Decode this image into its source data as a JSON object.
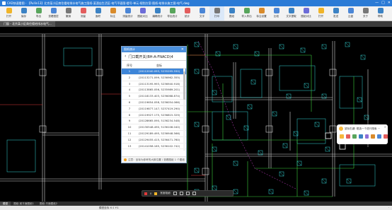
{
  "window": {
    "title": "CAD快速看图 - 【Pullin13】北京某小区商住楼给排水电气施工图纸-某酒店生活区-电气平面图-楼号-单元-规划方案-图纸-给排水施工图-电气.dwg",
    "controls": [
      "—",
      "□",
      "✕"
    ]
  },
  "toolbar": {
    "items": [
      {
        "label": "打开",
        "color": "#f0b429"
      },
      {
        "label": "保存",
        "color": "#3b82c4"
      },
      {
        "label": "导出",
        "color": "#58a55c"
      },
      {
        "label": "查看图层",
        "color": "#4b86d6"
      },
      {
        "label": "撤销",
        "color": "#777777"
      },
      {
        "label": "测量",
        "color": "#e35d5d"
      },
      {
        "label": "面积",
        "color": "#3b82c4"
      },
      {
        "label": "标注",
        "color": "#d98b2b"
      },
      {
        "label": "测量统计",
        "color": "#4b86d6"
      },
      {
        "label": "图纸对比",
        "color": "#6c6cd8"
      },
      {
        "label": "编辑统计",
        "color": "#3b82c4"
      },
      {
        "label": "导出统计",
        "color": "#58a55c"
      },
      {
        "label": "统计",
        "color": "#e35d5d"
      },
      {
        "label": "文字",
        "color": "#4b86d6"
      },
      {
        "label": "打印",
        "color": "#777777"
      },
      {
        "label": "图纸",
        "color": "#3b82c4"
      },
      {
        "label": "导入导出",
        "color": "#58a55c"
      },
      {
        "label": "标注设置",
        "color": "#d98b2b"
      },
      {
        "label": "比较",
        "color": "#4b86d6"
      },
      {
        "label": "文字提取",
        "color": "#3b82c4"
      },
      {
        "label": "图纸对比",
        "color": "#6c6cd8"
      },
      {
        "label": "打开",
        "color": "#f0b429"
      },
      {
        "label": "发送",
        "color": "#3b82c4"
      },
      {
        "label": "云盘",
        "color": "#4b86d6"
      },
      {
        "label": "关于",
        "color": "#777777"
      },
      {
        "label": "帮助",
        "color": "#3b82c4"
      }
    ]
  },
  "file_tab": "门窗 - 北京某小区商住楼给排水电气...",
  "dialog": {
    "header": "图纸统计",
    "back": "‹",
    "title": "门口截开关(BH-A-FNACD)4",
    "columns": [
      "序号",
      "坐标"
    ],
    "rows": [
      {
        "no": "1",
        "coord": "(20112040.093, 5235295.550)"
      },
      {
        "no": "2",
        "coord": "(20113271.099, 5236962.355)"
      },
      {
        "no": "3",
        "coord": "(20113195.993, 5236940.916)"
      },
      {
        "no": "4",
        "coord": "(20113865.056, 5235989.201)"
      },
      {
        "no": "5",
        "coord": "(20118133.403, 5236068.874)"
      },
      {
        "no": "6",
        "coord": "(20119654.058, 5236054.066)"
      },
      {
        "no": "7",
        "coord": "(20119877.147, 5237419.290)"
      },
      {
        "no": "8",
        "coord": "(20119927.175, 5236815.329)"
      },
      {
        "no": "9",
        "coord": "(20128665.090, 5136234.548)"
      },
      {
        "no": "10",
        "coord": "(20130548.490, 5136108.040)"
      },
      {
        "no": "11",
        "coord": "(20129189.495, 5236948.566)"
      },
      {
        "no": "12",
        "coord": "(20129455.415, 5236471.760)"
      },
      {
        "no": "13",
        "coord": "(20141058.165, 5236102.742)"
      },
      {
        "no": "14",
        "coord": "(20141069.290, 5236107.550)"
      }
    ],
    "selected_row": 0,
    "footer": "注意：坐标为参考的大致位置 / 查看图纸 1 个图纸"
  },
  "float_panel": {
    "message": "鼠标右键: 框选一个进行搜索 ···",
    "close": "✕",
    "icon_colors": [
      "#f6b73c",
      "#e35d5d",
      "#58a55c",
      "#3b82c4",
      "#8e6fd8",
      "#d98b2b",
      "#4b86d6",
      "#e35d5d"
    ]
  },
  "canvas_tools": {
    "items": [
      "0",
      "宽度粗细"
    ],
    "buttons": 4
  },
  "layout_tabs": [
    "模型",
    "图纸-某平面图纸1",
    "图纸-平面图纸2"
  ],
  "status": {
    "coord": "模型坐标 X:1 Y:1",
    "right": "·"
  },
  "colors": {
    "title_bar": "#2b7bd6",
    "canvas_bg": "#000000",
    "cad_white": "#d8d8d8",
    "cad_cyan": "#34d6d6",
    "cad_green": "#3cd23c",
    "cad_red": "#e03a3a",
    "cad_magenta": "#d040d0",
    "selection": "#3d85d8"
  }
}
